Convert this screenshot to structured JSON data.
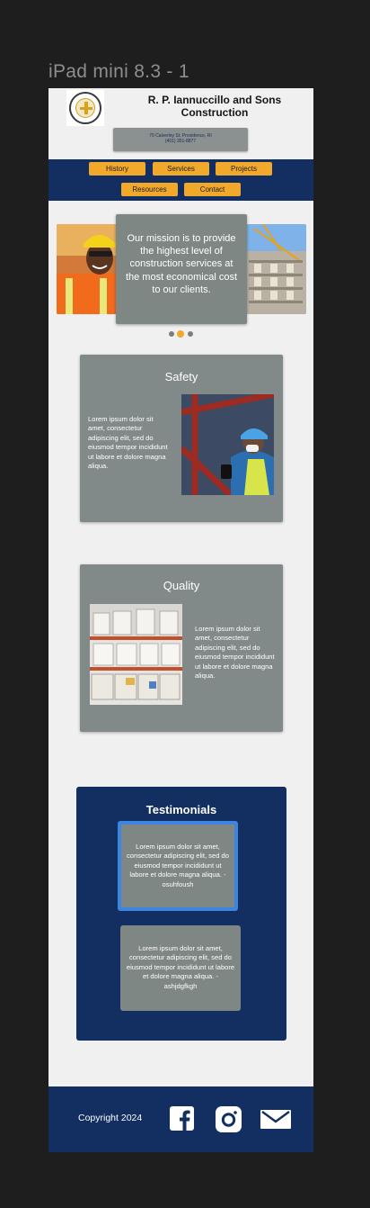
{
  "frame": {
    "label": "iPad mini 8.3 - 1"
  },
  "header": {
    "company_name": "R. P. Iannuccillo and Sons Construction",
    "address_line1": "70 Calverley St. Providence, RI",
    "address_line2": "(401) 351-8877"
  },
  "nav": {
    "items": [
      {
        "label": "History"
      },
      {
        "label": "Services"
      },
      {
        "label": "Projects"
      },
      {
        "label": "Resources"
      },
      {
        "label": "Contact"
      }
    ]
  },
  "hero": {
    "mission": "Our mission is to provide the highest level of construction services at the most economical cost to our clients.",
    "carousel": {
      "slide_count": 3,
      "active_index": 1
    }
  },
  "safety": {
    "title": "Safety",
    "text": "Lorem ipsum dolor sit amet, consectetur adipiscing elit, sed do eiusmod tempor incididunt ut labore et dolore magna aliqua."
  },
  "quality": {
    "title": "Quality",
    "text": "Lorem ipsum dolor sit amet, consectetur adipiscing elit, sed do eiusmod tempor incididunt ut labore et dolore magna aliqua."
  },
  "testimonials": {
    "title": "Testimonials",
    "items": [
      {
        "text": "Lorem ipsum dolor sit amet, consectetur adipiscing elit, sed do eiusmod tempor incididunt ut labore et dolore magna aliqua. - osuhfoush"
      },
      {
        "text": "Lorem ipsum dolor sit amet, consectetur adipiscing elit, sed do eiusmod tempor incididunt ut labore et dolore magna aliqua. - ashjdgfkgh"
      }
    ]
  },
  "footer": {
    "copyright": "Copyright 2024",
    "icons": [
      "facebook-icon",
      "instagram-icon",
      "mail-icon"
    ]
  },
  "colors": {
    "navy": "#132f61",
    "accent_orange": "#f1a92c",
    "card_gray": "#818a88",
    "page_bg": "#f0f0f0",
    "active_blue": "#3c86e1"
  }
}
